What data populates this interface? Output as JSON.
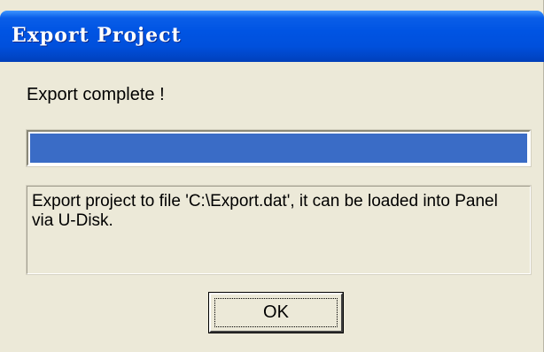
{
  "window": {
    "title": "Export Project"
  },
  "status": {
    "text": "Export complete !"
  },
  "progress": {
    "percent": 100,
    "fill_color": "#3a6cc6"
  },
  "message": {
    "text": "Export project to file 'C:\\Export.dat', it can be loaded into Panel via U-Disk."
  },
  "buttons": {
    "ok_label": "OK"
  },
  "colors": {
    "titlebar": "#0054e3",
    "dialog_bg": "#ece9d8"
  }
}
